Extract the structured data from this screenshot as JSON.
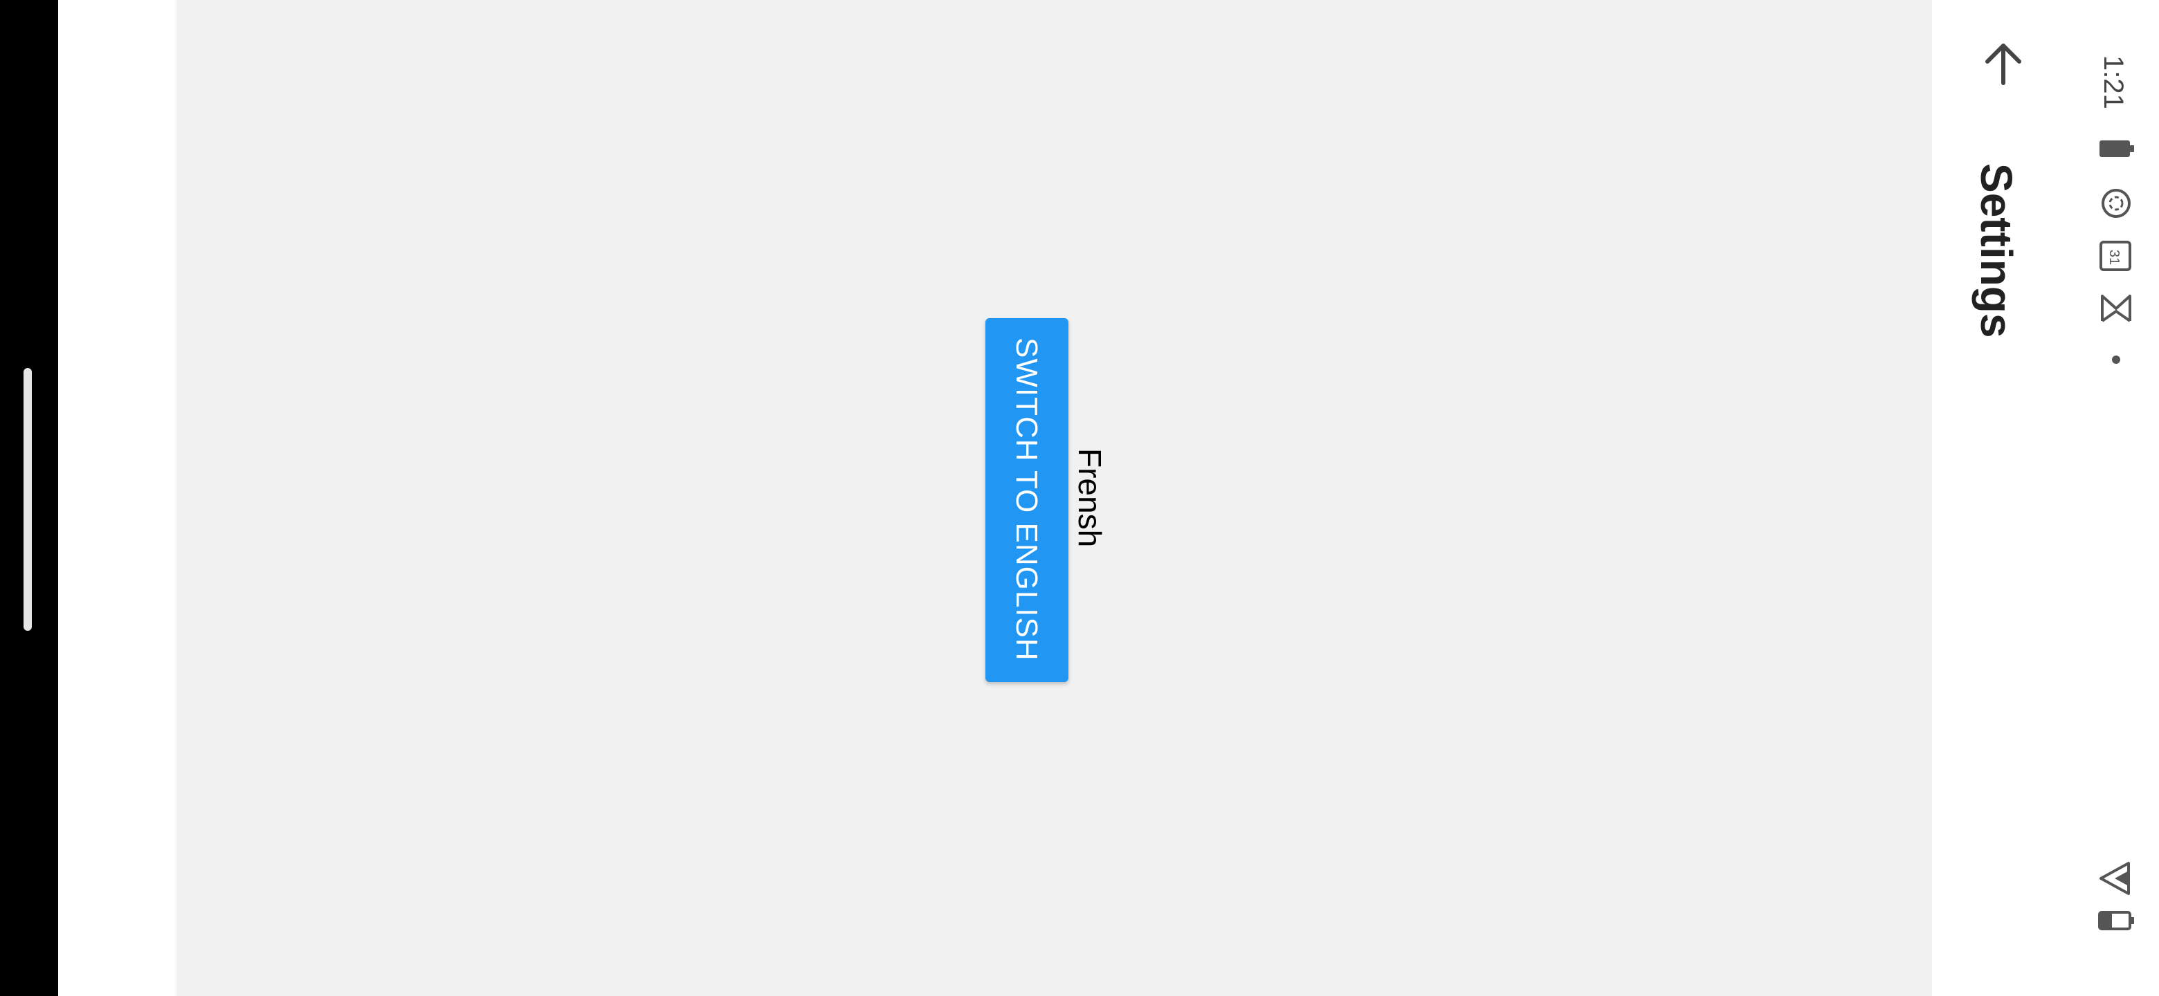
{
  "status_bar": {
    "time": "1:21",
    "left_icons": [
      "battery-icon",
      "sync-icon",
      "calendar-icon",
      "gmail-icon",
      "dot-icon"
    ],
    "right_icons": [
      "signal-icon",
      "battery-status-icon"
    ],
    "calendar_day": "31"
  },
  "app_bar": {
    "title": "Settings",
    "back_icon": "arrow-up-icon"
  },
  "main": {
    "language_label": "Frensh",
    "switch_button_label": "SWITCH TO ENGLISH"
  },
  "colors": {
    "accent": "#2196f3",
    "content_bg": "#f1f1f1",
    "nav_bg": "#000000"
  }
}
